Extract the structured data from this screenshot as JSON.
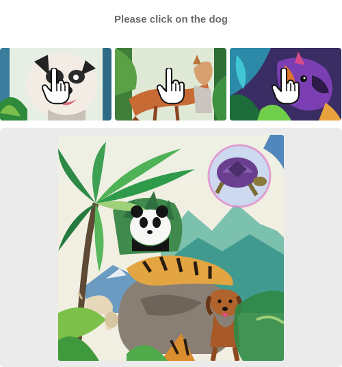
{
  "prompt": {
    "instruction": "Please click on the dog"
  },
  "examples": [
    {
      "icon": "pointer-hand-icon",
      "subject": "dog"
    },
    {
      "icon": "pointer-hand-icon",
      "subject": "dog"
    },
    {
      "icon": "pointer-hand-icon",
      "subject": "dog"
    }
  ],
  "challenge": {
    "subjects": [
      "palm-tree",
      "panda",
      "turtle-bubble",
      "tiger",
      "rhino",
      "cow",
      "dog",
      "mountains"
    ]
  },
  "colors": {
    "title": "#6b6b6b",
    "stage_bg": "#ebebeb",
    "page_bg": "#ffffff"
  }
}
